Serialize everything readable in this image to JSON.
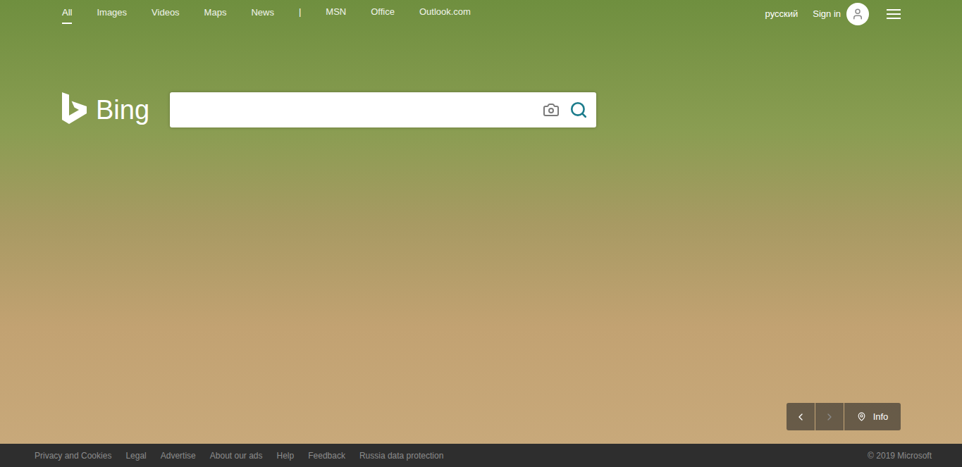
{
  "top_nav": {
    "items": [
      {
        "label": "All",
        "selected": true
      },
      {
        "label": "Images",
        "selected": false
      },
      {
        "label": "Videos",
        "selected": false
      },
      {
        "label": "Maps",
        "selected": false
      },
      {
        "label": "News",
        "selected": false
      }
    ],
    "separator": "|",
    "apps": [
      {
        "label": "MSN"
      },
      {
        "label": "Office"
      },
      {
        "label": "Outlook.com"
      }
    ]
  },
  "account": {
    "language": "русский",
    "sign_in": "Sign in"
  },
  "logo": {
    "text": "Bing"
  },
  "search": {
    "value": ""
  },
  "image_controls": {
    "previous": {
      "disabled": false
    },
    "next": {
      "disabled": true
    },
    "info": "Info"
  },
  "footer": {
    "links": [
      "Privacy and Cookies",
      "Legal",
      "Advertise",
      "About our ads",
      "Help",
      "Feedback",
      "Russia data protection"
    ],
    "copyright": "© 2019 Microsoft"
  }
}
